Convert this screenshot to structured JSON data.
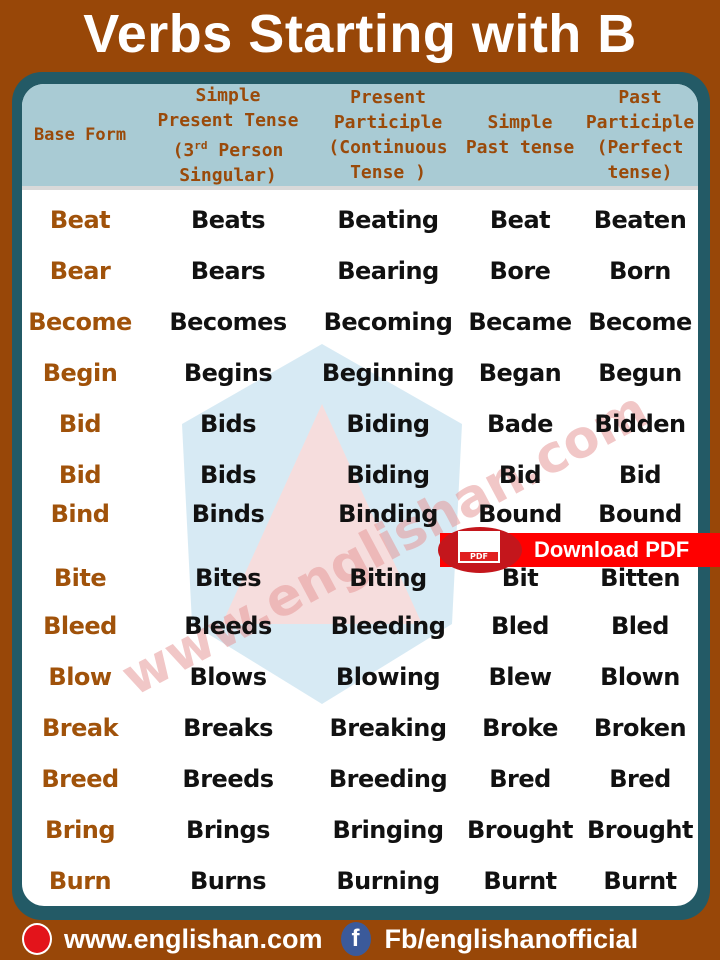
{
  "title": "Verbs Starting with B",
  "headers": {
    "base": "Base Form",
    "sp1": "Simple",
    "sp2": "Present Tense",
    "sp3a": "(3",
    "sp3b": "rd",
    "sp3c": " Person",
    "sp4": "Singular)",
    "pp1": "Present",
    "pp2": "Participle",
    "pp3": "(Continuous",
    "pp4": "Tense )",
    "spt1": "Simple",
    "spt2": "Past tense",
    "pap1": "Past",
    "pap2": "Participle",
    "pap3": "(Perfect",
    "pap4": "tense)"
  },
  "rows": [
    [
      "Beat",
      "Beats",
      "Beating",
      "Beat",
      "Beaten"
    ],
    [
      "Bear",
      "Bears",
      "Bearing",
      "Bore",
      "Born"
    ],
    [
      "Become",
      "Becomes",
      "Becoming",
      "Became",
      "Become"
    ],
    [
      "Begin",
      "Begins",
      "Beginning",
      "Began",
      "Begun"
    ],
    [
      "Bid",
      "Bids",
      "Biding",
      "Bade",
      "Bidden"
    ],
    [
      "Bid",
      "Bids",
      "Biding",
      "Bid",
      "Bid"
    ],
    [
      "Bind",
      "Binds",
      "Binding",
      "Bound",
      "Bound"
    ],
    [
      "Bite",
      "Bites",
      "Biting",
      "Bit",
      "Bitten"
    ],
    [
      "Bleed",
      "Bleeds",
      "Bleeding",
      "Bled",
      "Bled"
    ],
    [
      "Blow",
      "Blows",
      "Blowing",
      "Blew",
      "Blown"
    ],
    [
      "Break",
      "Breaks",
      "Breaking",
      "Broke",
      "Broken"
    ],
    [
      "Breed",
      "Breeds",
      "Breeding",
      "Bred",
      "Bred"
    ],
    [
      "Bring",
      "Brings",
      "Bringing",
      "Brought",
      "Brought"
    ],
    [
      "Burn",
      "Burns",
      "Burning",
      "Burnt",
      "Burnt"
    ]
  ],
  "watermark": "www.englishan.com",
  "pdf": {
    "icon_text": "PDF",
    "label": "Download PDF"
  },
  "footer": {
    "website": "www.englishan.com",
    "facebook_icon": "f",
    "facebook": "Fb/englishanofficial"
  },
  "colors": {
    "background": "#984708",
    "panel": "#235a66",
    "header": "#a9cbd4",
    "base_form": "#a0520a",
    "pdf": "#ff0000"
  }
}
